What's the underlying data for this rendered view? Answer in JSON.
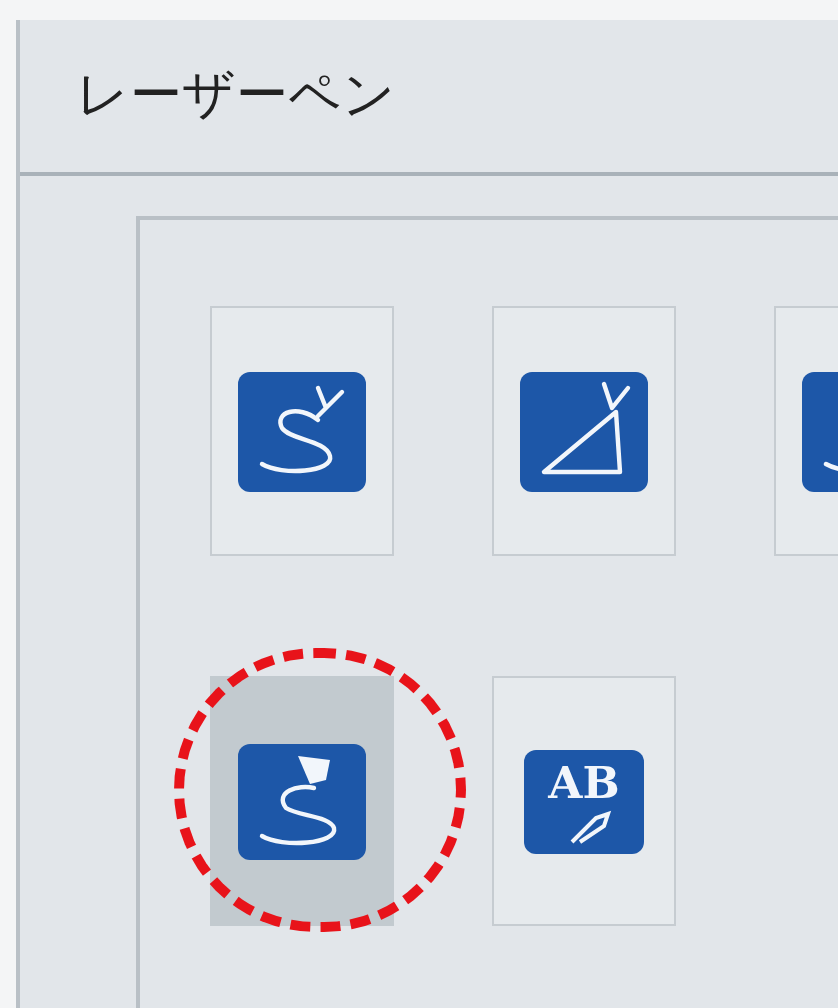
{
  "title": "レーザーペン",
  "tools": [
    {
      "kind": "freehand",
      "selected": false,
      "circled": false
    },
    {
      "kind": "triangle",
      "selected": false,
      "circled": false
    },
    {
      "kind": "freehand",
      "selected": false,
      "circled": false
    },
    {
      "kind": "spotlight",
      "selected": true,
      "circled": true
    },
    {
      "kind": "text",
      "label": "AB",
      "selected": false,
      "circled": false
    }
  ]
}
